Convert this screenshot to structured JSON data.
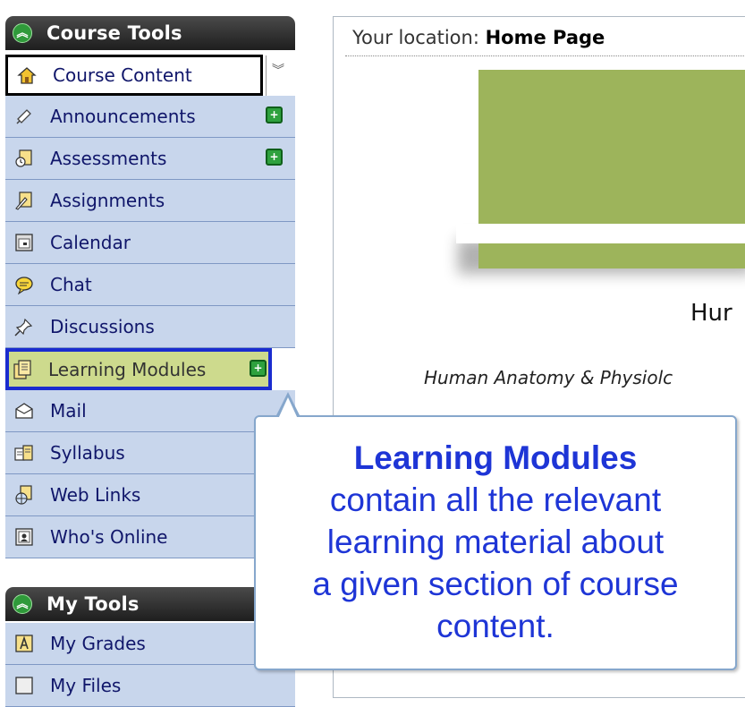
{
  "course_tools": {
    "title": "Course Tools",
    "collapse_glyph": "»",
    "items": [
      {
        "label": "Course Content",
        "icon": "home-icon"
      },
      {
        "label": "Announcements",
        "icon": "megaphone-icon",
        "new": true
      },
      {
        "label": "Assessments",
        "icon": "assessment-icon",
        "new": true
      },
      {
        "label": "Assignments",
        "icon": "assignment-icon"
      },
      {
        "label": "Calendar",
        "icon": "calendar-icon"
      },
      {
        "label": "Chat",
        "icon": "chat-icon"
      },
      {
        "label": "Discussions",
        "icon": "pushpin-icon"
      },
      {
        "label": "Learning Modules",
        "icon": "learning-module-icon",
        "new": true
      },
      {
        "label": "Mail",
        "icon": "mail-icon"
      },
      {
        "label": "Syllabus",
        "icon": "syllabus-icon"
      },
      {
        "label": "Web Links",
        "icon": "globe-icon"
      },
      {
        "label": "Who's Online",
        "icon": "whos-online-icon"
      }
    ]
  },
  "my_tools": {
    "title": "My Tools",
    "items": [
      {
        "label": "My Grades",
        "icon": "grades-icon"
      },
      {
        "label": "My Files",
        "icon": "files-icon"
      }
    ]
  },
  "content": {
    "location_label": "Your location:",
    "location_value": "Home Page",
    "course_title": "Hur",
    "course_subtitle": "Human Anatomy & Physiolc"
  },
  "callout": {
    "title": "Learning Modules",
    "lines": [
      "contain all the relevant",
      "learning material about",
      "a given section of course",
      "content."
    ]
  },
  "colors": {
    "header_dark": "#1e1e1e",
    "nav_item_bg": "#c8d6ec",
    "highlight_bg": "#cdda8d",
    "highlight_border": "#1a2ccf",
    "banner_olive": "#9db45b",
    "callout_text": "#1e35d6"
  }
}
